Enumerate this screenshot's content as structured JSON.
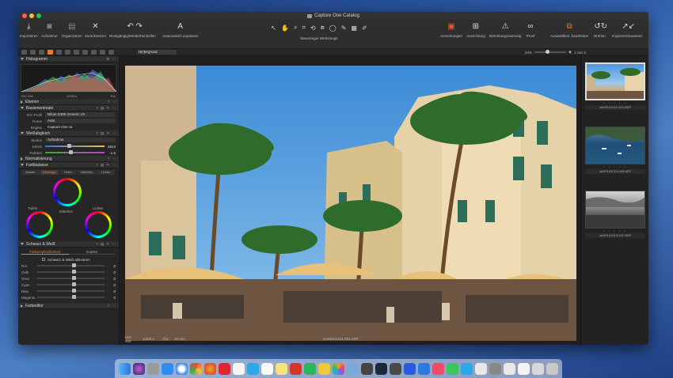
{
  "window": {
    "title": "Capture One Catalog"
  },
  "toolbar": {
    "left_buttons": [
      "Importieren",
      "Aufnahme",
      "Organisieren",
      "Zurücksetzen",
      "Rückgängig/Wiederherstellen",
      "Automatisch anpassen"
    ],
    "cursor_label": "Mauszeiger Werkzeuge",
    "right_buttons": [
      "Anmerkungen",
      "Ausrichtung",
      "Belichtungswarnung",
      "Proof",
      "Auswahlkorr. bearbeiten",
      "Drehen",
      "Kopieren/Zuweisen"
    ]
  },
  "subbar": {
    "background": "Hintergrund",
    "zoom": "34%",
    "counter": "1 von 3"
  },
  "left_panel": {
    "histogram": {
      "title": "Histogramm",
      "iso": "ISO 200",
      "shutter": "1/200 s",
      "aperture": "f/11"
    },
    "sections": {
      "layers": "Ebenen",
      "base": "Basismerkmale",
      "wb": "Weißabgleich",
      "norm": "Normalisierung",
      "cb": "Farbbalance",
      "bw": "Schwarz & Weiß",
      "fe": "Farbeditor"
    },
    "base": {
      "icc_label": "ICC-Profil",
      "icc_value": "Nikon D300 Generic V2",
      "curve_label": "Kurve",
      "curve_value": "Auto",
      "engine_label": "Engine",
      "engine_value": "Capture One 11"
    },
    "wb": {
      "mode_label": "Modus",
      "mode_value": "Aufnahme",
      "kelvin_label": "Kelvin",
      "kelvin_value": "4913",
      "tint_label": "Farbton",
      "tint_value": "-1.6"
    },
    "cb": {
      "tabs": [
        "Master",
        "Dreiwege",
        "Tiefen",
        "Mitteltön",
        "Lichter"
      ],
      "labels": {
        "shadows": "Tiefen",
        "mid": "Mitteltön",
        "high": "Lichter"
      }
    },
    "bw": {
      "tabs": [
        "Farbempfindlichkeit",
        "Duplex"
      ],
      "enable": "Schwarz & Weiß aktivieren",
      "channels": [
        "Rot",
        "Gelb",
        "Grün",
        "Cyan",
        "Blau",
        "Magenta"
      ],
      "values": [
        "0",
        "0",
        "0",
        "0",
        "0",
        "0"
      ]
    }
  },
  "viewer": {
    "info_iso": "ISO 200",
    "info_shutter": "1/200 s",
    "info_ap": "f/11",
    "info_focal": "18 mm",
    "filename": "set20141011-004.NEF"
  },
  "browser": {
    "thumbs": [
      "set20141011-004.NEF",
      "set20141013-043.NEF",
      "set20141013-047.NEF"
    ]
  },
  "colors": {
    "accent": "#f07a2a"
  }
}
